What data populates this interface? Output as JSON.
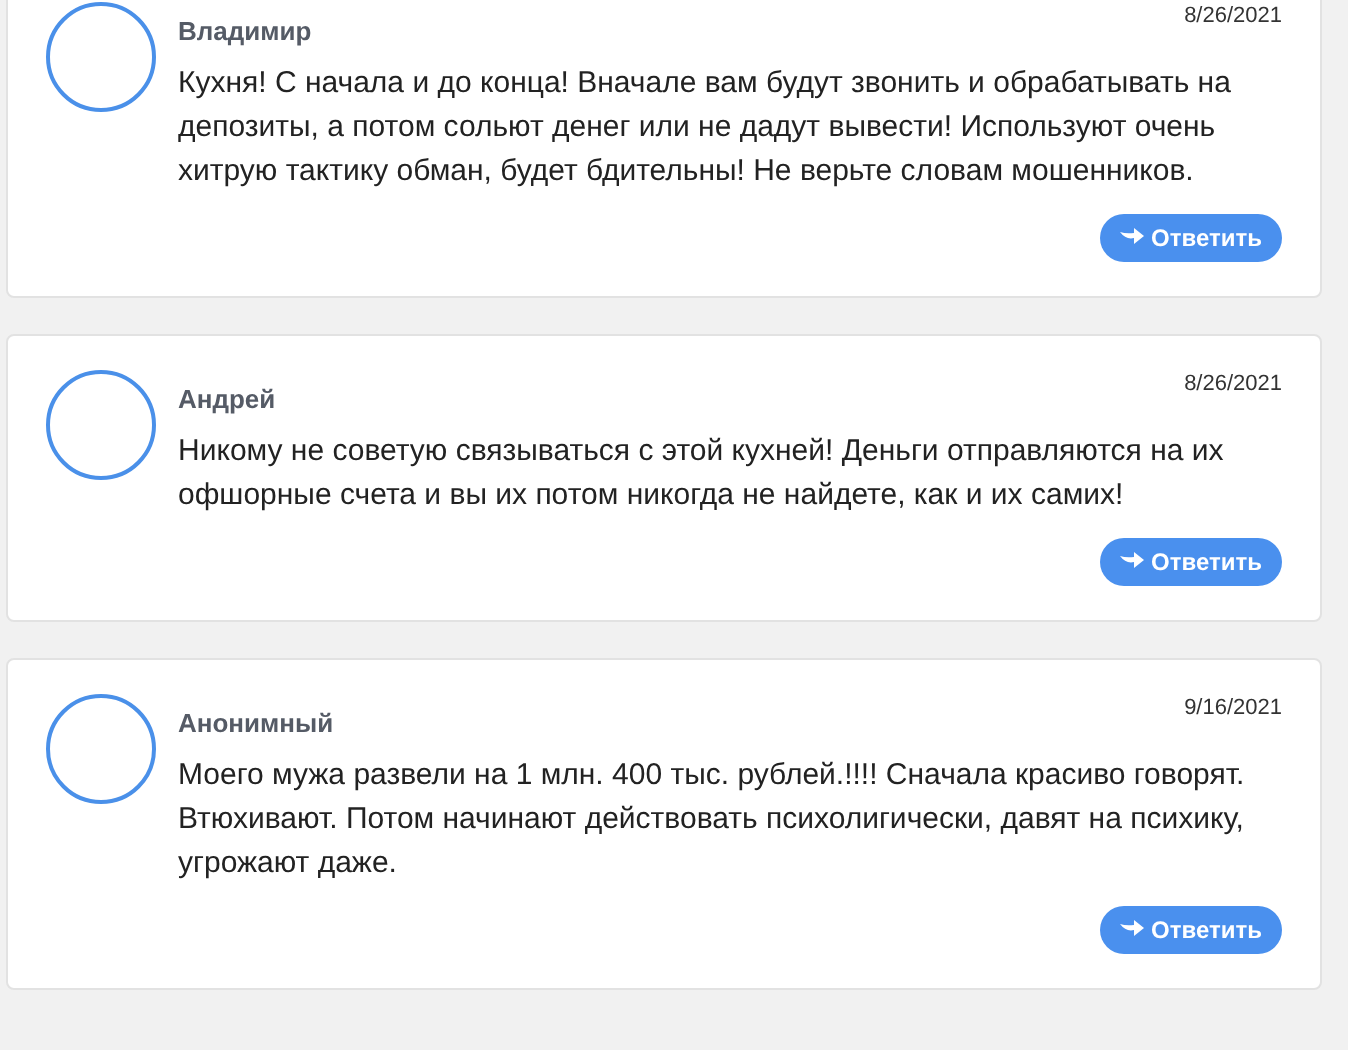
{
  "comments": [
    {
      "author": "Владимир",
      "date": "8/26/2021",
      "text": "Кухня! С начала и до конца! Вначале вам будут звонить и обрабатывать на депозиты, а потом сольют денег или не дадут вывести! Используют очень хитрую тактику обман, будет бдительны! Не верьте словам мошенников.",
      "reply": "Ответить"
    },
    {
      "author": "Андрей",
      "date": "8/26/2021",
      "text": "Никому не советую связываться с этой кухней! Деньги отправляются на их офшорные счета и вы их потом никогда не найдете, как и их самих!",
      "reply": "Ответить"
    },
    {
      "author": "Анонимный",
      "date": "9/16/2021",
      "text": "Моего мужа развели на 1 млн. 400 тыс. рублей.!!!! Сначала красиво говорят. Втюхивают. Потом начинают действовать психолигически, давят на психику, угрожают даже.",
      "reply": "Ответить"
    }
  ]
}
